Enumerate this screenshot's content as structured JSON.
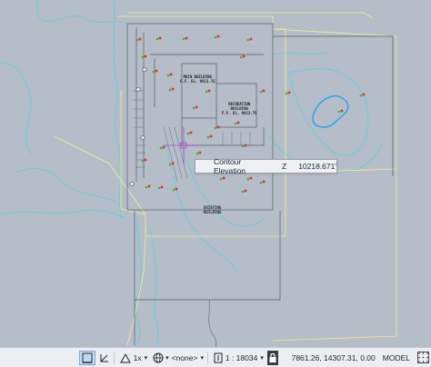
{
  "tooltip": {
    "property": "Contour Elevation",
    "axis": "Z",
    "value": "10218.671'"
  },
  "buildings": [
    {
      "name": "MAIN BUILDING\nF.F. EL. 9813.75"
    },
    {
      "name": "RECREATION\nBUILDING\nF.F. EL. 9813.75"
    },
    {
      "name": "EXISTING\nBUILDING"
    }
  ],
  "statusbar": {
    "scale_multiplier": "1x",
    "annotation_visibility": "<none>",
    "scale": "1 : 18034",
    "coordinates": "7861.26, 14307.31, 0.00",
    "space": "MODEL"
  },
  "colors": {
    "viewport_bg": "#b5bdc9",
    "contour_cyan": "#3fd6e6",
    "boundary_yellow": "#f2ef86",
    "site_gray": "#6a7280",
    "tree_red": "#e53a2a",
    "tree_green": "#2fbe2f",
    "crosshair": "#b23fd6"
  }
}
